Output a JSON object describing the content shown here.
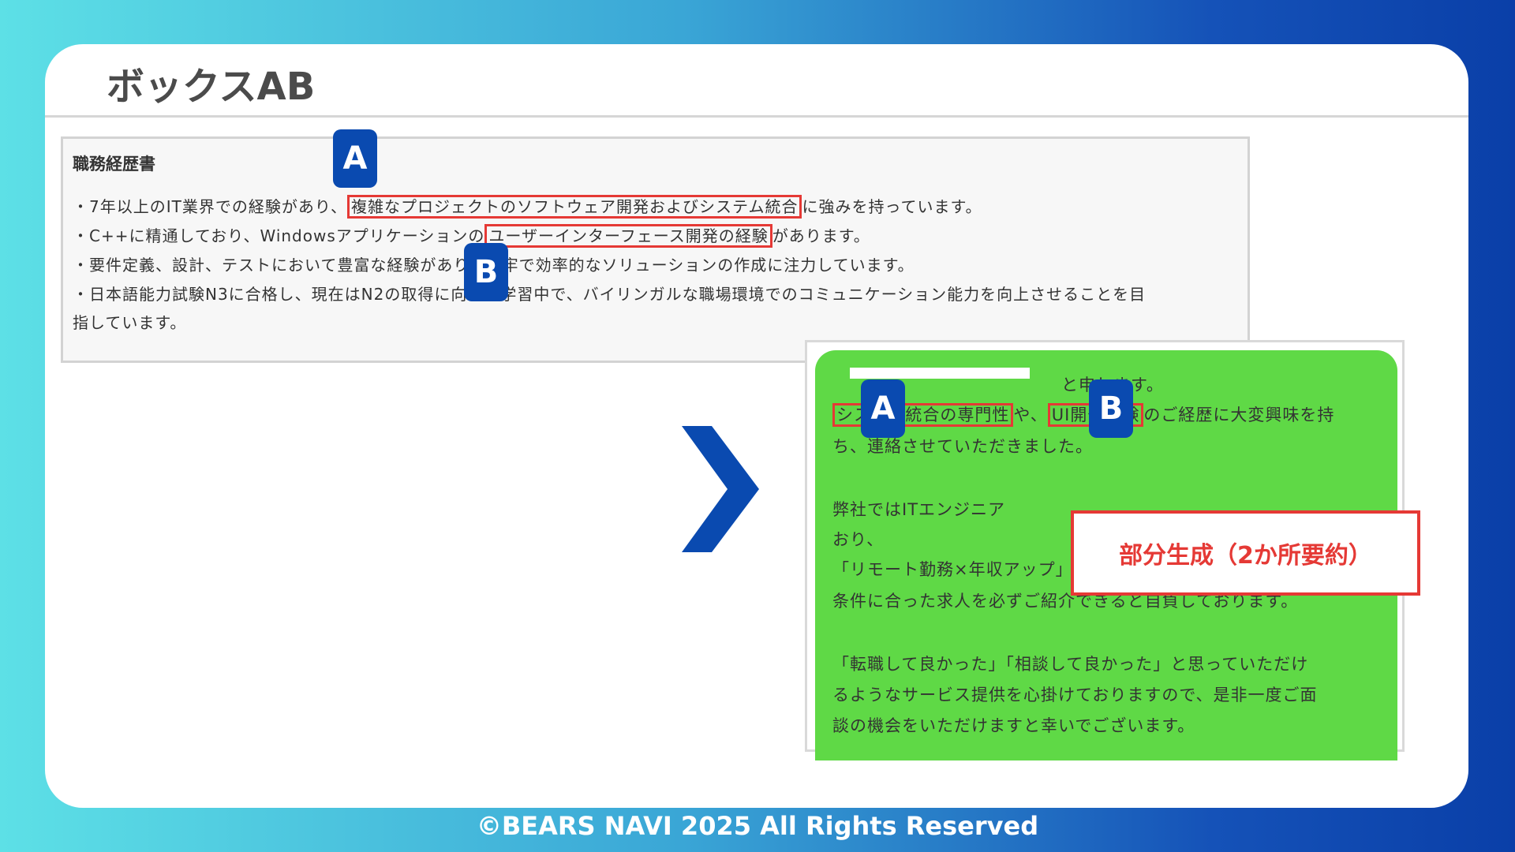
{
  "title": "ボックスAB",
  "resume": {
    "heading": "職務経歴書",
    "line1": {
      "pre": "・7年以上のIT業界での経験があり、",
      "highlight": "複雑なプロジェクトのソフトウェア開発およびシステム統合",
      "post": "に強みを持っています。"
    },
    "line2": {
      "pre": "・C++に精通しており、Windowsアプリケーションの",
      "highlight": "ユーザーインターフェース開発の経験",
      "post": "があります。"
    },
    "line3": "・要件定義、設計、テストにおいて豊富な経験があり、堅牢で効率的なソリューションの作成に注力しています。",
    "line4": "・日本語能力試験N3に合格し、現在はN2の取得に向けて学習中で、バイリンガルな職場環境でのコミュニケーション能力を向上させることを目",
    "line5": "指しています。"
  },
  "badges": {
    "a": "A",
    "b": "B"
  },
  "email": {
    "line0": "と申します。",
    "line1": {
      "hl1": "システム統合の専門性",
      "mid": "や、",
      "hl2": "UI開発経験",
      "post": "のご経歴に大変興味を持"
    },
    "line2": "ち、連絡させていただきました。",
    "line3": "弊社ではITエンジニア",
    "line4": "おり、",
    "line5": "「リモート勤務×年収アップ」「残業少×年収アップ」など、",
    "line6": "条件に合った求人を必ずご紹介できると自負しております。",
    "line7": "「転職して良かった」「相談して良かった」と思っていただけ",
    "line8": "るようなサービス提供を心掛けておりますので、是非一度ご面",
    "line9": "談の機会をいただけますと幸いでございます。"
  },
  "partial_label": "部分生成（2か所要約）",
  "footer": "©BEARS NAVI 2025 All Rights Reserved",
  "colors": {
    "accent_red": "#e53935",
    "badge_blue": "#0a4ab0",
    "email_green": "#5fd946"
  }
}
